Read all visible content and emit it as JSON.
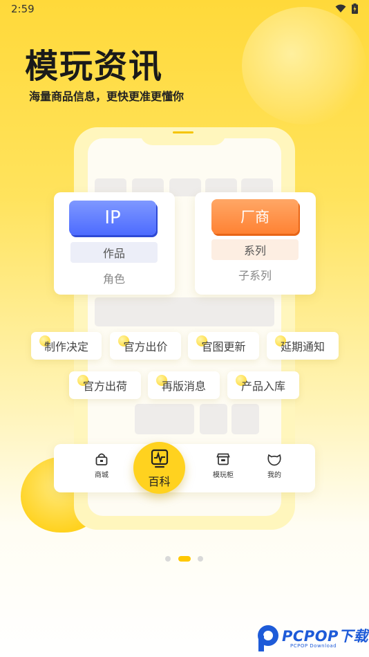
{
  "status_bar": {
    "time": "2:59"
  },
  "hero": {
    "title": "模玩资讯",
    "subtitle": "海量商品信息，更快更准更懂你"
  },
  "cards": {
    "ip": {
      "button": "IP",
      "level1": "作品",
      "level2": "角色"
    },
    "manufacturer": {
      "button": "厂商",
      "level1": "系列",
      "level2": "子系列"
    }
  },
  "tags": [
    "制作决定",
    "官方出价",
    "官图更新",
    "延期通知",
    "官方出荷",
    "再版消息",
    "产品入库"
  ],
  "nav": {
    "items": [
      {
        "label": "商城",
        "icon": "bag-icon"
      },
      {
        "label": "百科",
        "icon": "pulse-chart-icon"
      },
      {
        "label": "模玩柜",
        "icon": "cabinet-icon"
      },
      {
        "label": "我的",
        "icon": "cat-face-icon"
      }
    ]
  },
  "pager": {
    "count": 3,
    "active": 1
  },
  "watermark": {
    "text": "PCPOP下载",
    "sub": "PCPOP Download"
  },
  "colors": {
    "brand_yellow": "#ffd21f",
    "ip_blue": "#4d6bff",
    "manufacturer_orange": "#ff8233",
    "watermark_blue": "#1e5bd8"
  }
}
